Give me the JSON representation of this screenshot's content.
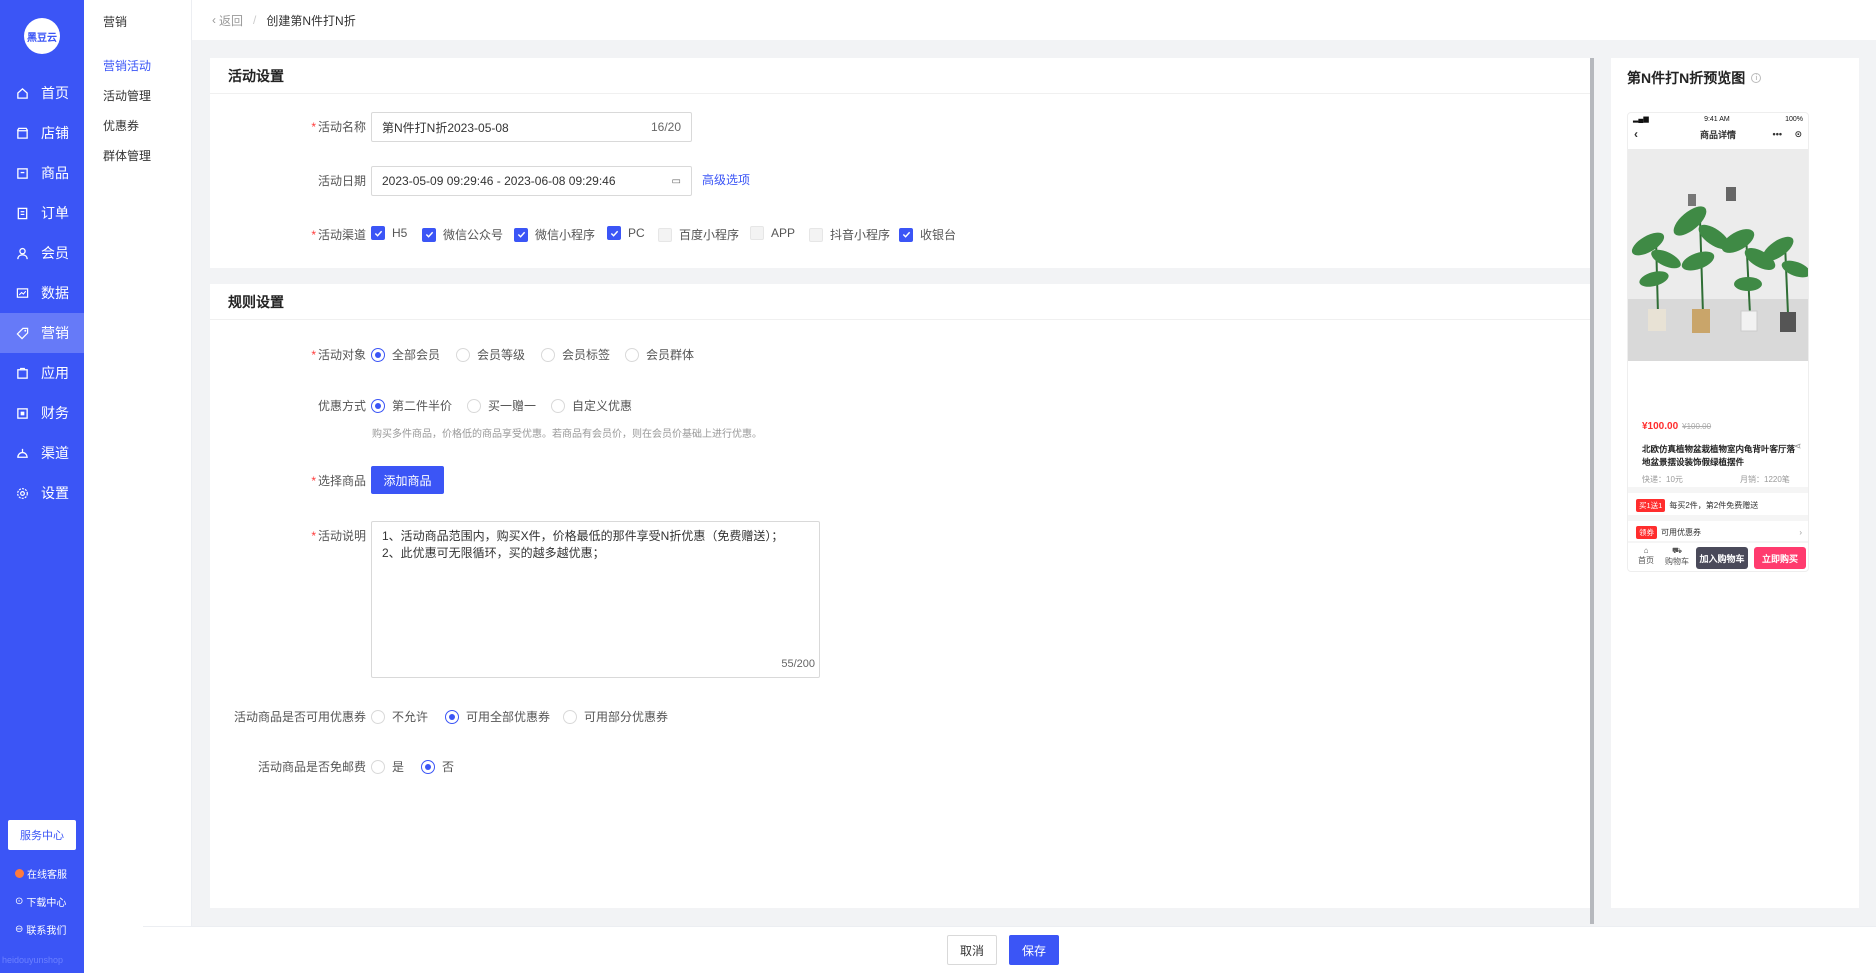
{
  "nav": {
    "logo": "黑豆云",
    "items": [
      {
        "label": "首页",
        "icon": "home-icon"
      },
      {
        "label": "店铺",
        "icon": "store-icon"
      },
      {
        "label": "商品",
        "icon": "goods-icon"
      },
      {
        "label": "订单",
        "icon": "order-icon"
      },
      {
        "label": "会员",
        "icon": "member-icon"
      },
      {
        "label": "数据",
        "icon": "chart-icon"
      },
      {
        "label": "营销",
        "icon": "tag-icon"
      },
      {
        "label": "应用",
        "icon": "app-icon"
      },
      {
        "label": "财务",
        "icon": "finance-icon"
      },
      {
        "label": "渠道",
        "icon": "channel-icon"
      },
      {
        "label": "设置",
        "icon": "gear-icon"
      }
    ],
    "service_center": "服务中心",
    "online_support": "在线客服",
    "download_center": "下载中心",
    "contact_us": "联系我们",
    "footer_mark": "heidouyunshop"
  },
  "submenu": {
    "title": "营销",
    "items": [
      "营销活动",
      "活动管理",
      "优惠券",
      "群体管理"
    ]
  },
  "breadcrumb": {
    "back": "返回",
    "separator": "/",
    "current": "创建第N件打N折"
  },
  "activity": {
    "section_title": "活动设置",
    "name_label": "活动名称",
    "name_value": "第N件打N折2023-05-08",
    "name_count": "16/20",
    "date_label": "活动日期",
    "date_value": "2023-05-09 09:29:46 - 2023-06-08 09:29:46",
    "advanced": "高级选项",
    "channel_label": "活动渠道",
    "channels": [
      {
        "label": "H5",
        "state": "checked"
      },
      {
        "label": "微信公众号",
        "state": "checked"
      },
      {
        "label": "微信小程序",
        "state": "checked"
      },
      {
        "label": "PC",
        "state": "checked"
      },
      {
        "label": "百度小程序",
        "state": "disabled"
      },
      {
        "label": "APP",
        "state": "disabled"
      },
      {
        "label": "抖音小程序",
        "state": "disabled"
      },
      {
        "label": "收银台",
        "state": "checked"
      }
    ]
  },
  "rules": {
    "section_title": "规则设置",
    "target_label": "活动对象",
    "targets": [
      "全部会员",
      "会员等级",
      "会员标签",
      "会员群体"
    ],
    "target_selected": 0,
    "discount_label": "优惠方式",
    "discounts": [
      "第二件半价",
      "买一赠一",
      "自定义优惠"
    ],
    "discount_selected": 0,
    "discount_hint": "购买多件商品，价格低的商品享受优惠。若商品有会员价，则在会员价基础上进行优惠。",
    "goods_label": "选择商品",
    "add_goods": "添加商品",
    "desc_label": "活动说明",
    "desc_line1": "1、活动商品范围内，购买X件，价格最低的那件享受N折优惠（免费赠送）；",
    "desc_line2": "2、此优惠可无限循环，买的越多越优惠；",
    "desc_count": "55/200",
    "coupon_label": "活动商品是否可用优惠券",
    "coupon_options": [
      "不允许",
      "可用全部优惠券",
      "可用部分优惠券"
    ],
    "coupon_selected": 1,
    "shipping_label": "活动商品是否免邮费",
    "shipping_options": [
      "是",
      "否"
    ],
    "shipping_selected": 1
  },
  "preview": {
    "title": "第N件打N折预览图",
    "status_time": "9:41 AM",
    "status_battery": "100%",
    "header": "商品详情",
    "price": "¥100.00",
    "old_price": "¥100.00",
    "product_name": "北欧仿真植物盆栽植物室内龟背叶客厅落地盆景摆设装饰假绿植摆件",
    "shipping": "快递：10元",
    "sales": "月销：1220笔",
    "promo_tag": "买1送1",
    "promo_text": "每买2件，第2件免费赠送",
    "coupon_tag": "领券",
    "coupon_text": "可用优惠券",
    "home": "首页",
    "cart": "购物车",
    "add_cart": "加入购物车",
    "buy_now": "立即购买"
  },
  "footer": {
    "cancel": "取消",
    "save": "保存"
  },
  "colors": {
    "primary": "#3b55f6",
    "danger": "#ff2d2d",
    "buy": "#ff3b6e",
    "cart": "#4a4a5a"
  }
}
